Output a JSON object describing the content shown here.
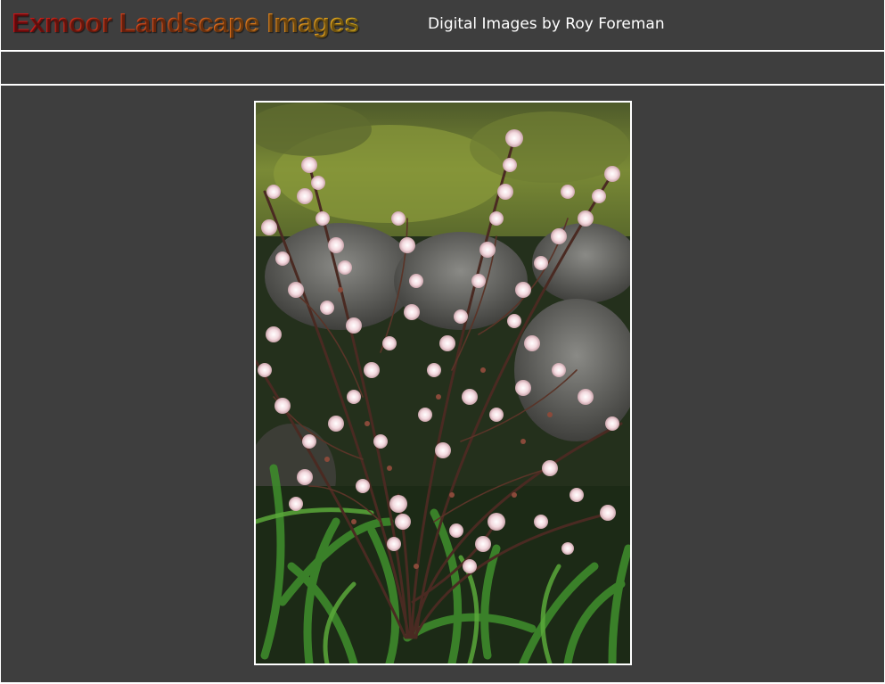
{
  "header": {
    "title": "Exmoor Landscape Images",
    "subtitle": "Digital Images by Roy Foreman",
    "title_gradient": [
      "#d4141a",
      "#e0481b",
      "#ea7a1e",
      "#f2c01f"
    ],
    "subtitle_color": "#ffffff"
  },
  "colors": {
    "background": "#3e3e3e",
    "rule": "#ffffff",
    "frame": "#ffffff"
  },
  "main": {
    "photo": {
      "icon": "photo-blossom-image"
    }
  }
}
